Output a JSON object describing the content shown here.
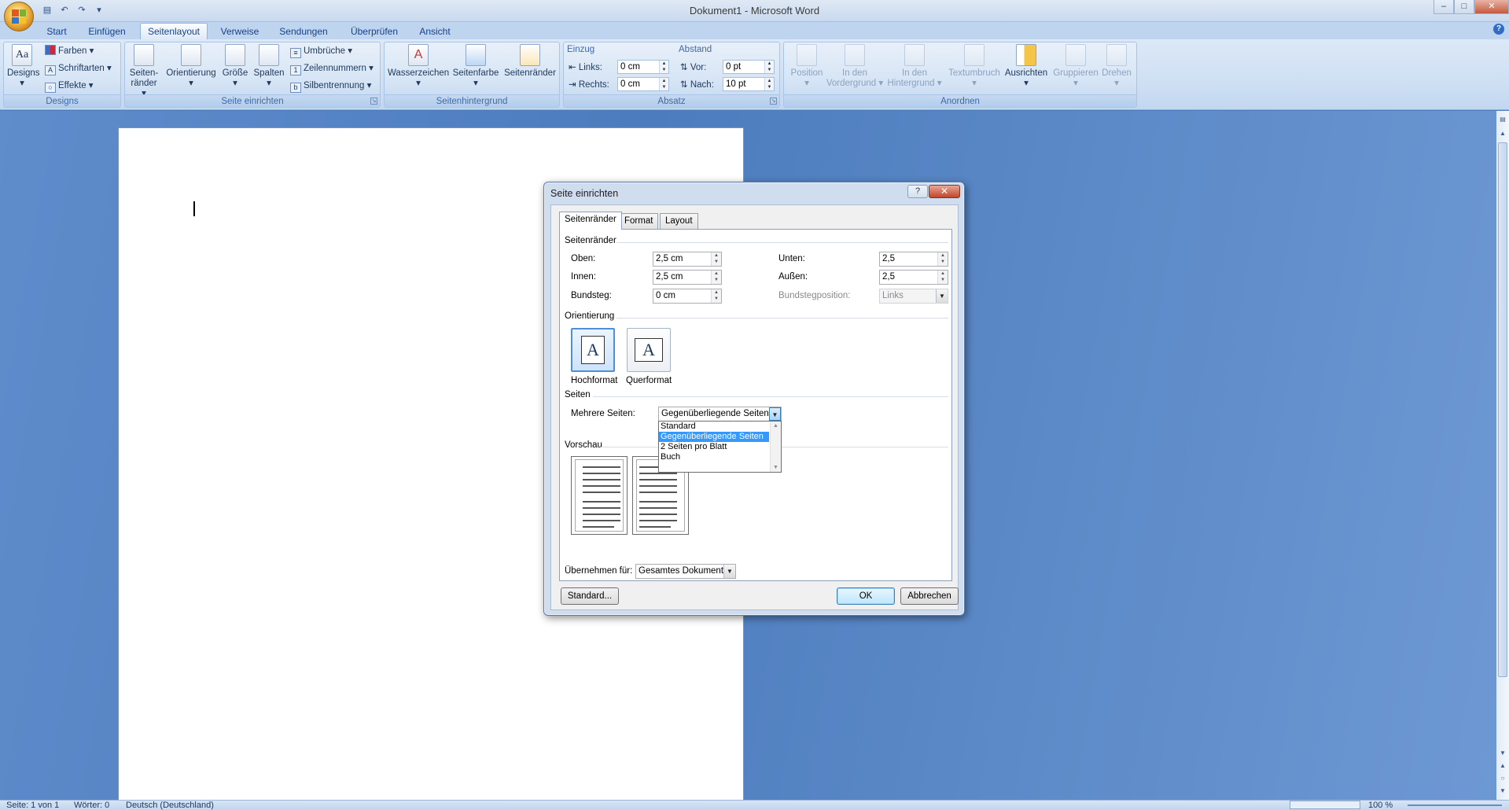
{
  "window": {
    "title": "Dokument1 - Microsoft Word",
    "controls": [
      "–",
      "□",
      "✕"
    ]
  },
  "quick_access": [
    "save-icon",
    "undo-icon",
    "redo-icon",
    "customize-qat-icon"
  ],
  "tabs": [
    {
      "label": "Start",
      "active": false
    },
    {
      "label": "Einfügen",
      "active": false
    },
    {
      "label": "Seitenlayout",
      "active": true
    },
    {
      "label": "Verweise",
      "active": false
    },
    {
      "label": "Sendungen",
      "active": false
    },
    {
      "label": "Überprüfen",
      "active": false
    },
    {
      "label": "Ansicht",
      "active": false
    }
  ],
  "ribbon": {
    "designs": {
      "label": "Designs",
      "button": "Designs",
      "farben": "Farben",
      "schriftarten": "Schriftarten",
      "effekte": "Effekte"
    },
    "seite_einrichten": {
      "label": "Seite einrichten",
      "seitenraender_l1": "Seiten-",
      "seitenraender_l2": "ränder",
      "orientierung": "Orientierung",
      "groesse": "Größe",
      "spalten": "Spalten",
      "umbrueche": "Umbrüche",
      "zeilennummern": "Zeilennummern",
      "silbentrennung": "Silbentrennung"
    },
    "seitenhintergrund": {
      "label": "Seitenhintergrund",
      "wasserzeichen": "Wasserzeichen",
      "seitenfarbe": "Seitenfarbe",
      "seitenraender": "Seitenränder"
    },
    "absatz": {
      "label": "Absatz",
      "einzug": "Einzug",
      "links_label": "Links:",
      "links_value": "0 cm",
      "rechts_label": "Rechts:",
      "rechts_value": "0 cm",
      "abstand": "Abstand",
      "vor_label": "Vor:",
      "vor_value": "0 pt",
      "nach_label": "Nach:",
      "nach_value": "10 pt"
    },
    "anordnen": {
      "label": "Anordnen",
      "position": "Position",
      "vordergrund_l1": "In den",
      "vordergrund_l2": "Vordergrund",
      "hintergrund_l1": "In den",
      "hintergrund_l2": "Hintergrund",
      "textumbruch": "Textumbruch",
      "ausrichten": "Ausrichten",
      "gruppieren": "Gruppieren",
      "drehen": "Drehen"
    }
  },
  "dialog": {
    "title": "Seite einrichten",
    "help": "?",
    "close": "✕",
    "tabs": [
      {
        "label": "Seitenränder",
        "active": true
      },
      {
        "label": "Format",
        "active": false
      },
      {
        "label": "Layout",
        "active": false
      }
    ],
    "margins": {
      "section": "Seitenränder",
      "oben_label": "Oben:",
      "oben_value": "2,5 cm",
      "unten_label": "Unten:",
      "unten_value": "2,5",
      "innen_label": "Innen:",
      "innen_value": "2,5 cm",
      "aussen_label": "Außen:",
      "aussen_value": "2,5",
      "bundsteg_label": "Bundsteg:",
      "bundsteg_value": "0 cm",
      "bundstegposition_label": "Bundstegposition:",
      "bundstegposition_value": "Links"
    },
    "orientation": {
      "section": "Orientierung",
      "hochformat": "Hochformat",
      "querformat": "Querformat",
      "selected": "Hochformat"
    },
    "pages": {
      "section": "Seiten",
      "mehrere_label": "Mehrere Seiten:",
      "mehrere_value": "Gegenüberliegende Seiten",
      "options": [
        "Standard",
        "Gegenüberliegende Seiten",
        "2 Seiten pro Blatt",
        "Buch"
      ],
      "highlighted": "Gegenüberliegende Seiten"
    },
    "preview": {
      "section": "Vorschau"
    },
    "apply": {
      "label": "Übernehmen für:",
      "value": "Gesamtes Dokument"
    },
    "buttons": {
      "standard": "Standard...",
      "ok": "OK",
      "cancel": "Abbrechen"
    }
  },
  "status": {
    "page": "Seite: 1 von 1",
    "words": "Wörter: 0",
    "language": "Deutsch (Deutschland)",
    "zoom": "100 %"
  }
}
